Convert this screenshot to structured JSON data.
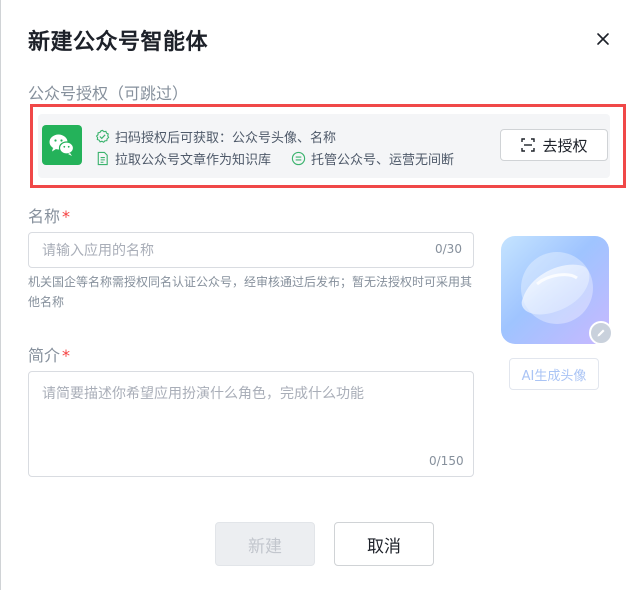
{
  "dialog": {
    "title": "新建公众号智能体"
  },
  "auth": {
    "section_label": "公众号授权（可跳过）",
    "features": [
      "扫码授权后可获取：公众号头像、名称",
      "拉取公众号文章作为知识库",
      "托管公众号、运营无间断"
    ],
    "button_label": "去授权"
  },
  "name": {
    "label": "名称",
    "required_mark": "*",
    "placeholder": "请输入应用的名称",
    "counter": "0/30",
    "hint": "机关国企等名称需授权同名认证公众号，经审核通过后发布；暂无法授权时可采用其他名称"
  },
  "intro": {
    "label": "简介",
    "required_mark": "*",
    "placeholder": "请简要描述你希望应用扮演什么角色，完成什么功能",
    "counter": "0/150"
  },
  "avatar": {
    "ai_button_label": "AI生成头像"
  },
  "footer": {
    "create_label": "新建",
    "cancel_label": "取消"
  },
  "colors": {
    "highlight_border": "#f04848",
    "wechat_green": "#24b25a",
    "ai_button_text": "#aac4f5"
  }
}
